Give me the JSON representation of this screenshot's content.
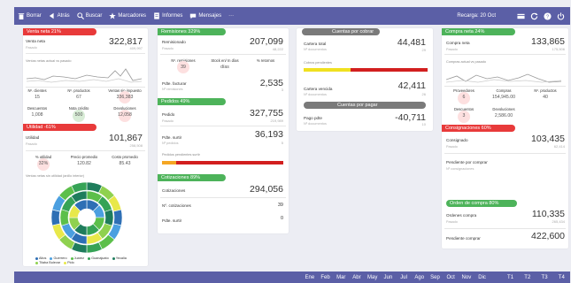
{
  "toolbar": {
    "items": [
      {
        "label": "Borrar"
      },
      {
        "label": "Atrás"
      },
      {
        "label": "Buscar"
      },
      {
        "label": "Marcadores"
      },
      {
        "label": "Informes"
      },
      {
        "label": "Mensajes"
      },
      {
        "label": "···"
      }
    ],
    "recarga": "Recarga: 20 Oct"
  },
  "venta": {
    "header": "Venta neta   21%",
    "title": "Venta neta",
    "subtitle": "Pasado",
    "value": "322,817",
    "past": "409,997",
    "chart_title": "Ventas netas actual vs pasado",
    "m1_label": "Nº. clientes",
    "m1_value": "15",
    "m2_label": "Nº. productos",
    "m2_value": "67",
    "m3_label": "Ventas sin impuesto",
    "m3_value": "336,383",
    "m4_label": "Descuentos",
    "m4_value": "1,008",
    "m5_label": "Nota crédito",
    "m5_value": "500",
    "m6_label": "Devoluciones",
    "m6_value": "12,058"
  },
  "utilidad": {
    "header": "Utilidad  -61%",
    "title": "Utilidad",
    "subtitle": "Pasado",
    "value": "101,867",
    "past": "258,508",
    "m1_label": "% utilidad",
    "m1_value": "32%",
    "m2_label": "Precio promedio",
    "m2_value": "120.82",
    "m3_label": "Costo promedio",
    "m3_value": "85.43",
    "donut_title": "Ventas netas sin utilidad (anillo interior)",
    "legend": [
      {
        "name": "Altos",
        "color": "#2e6fb5"
      },
      {
        "name": "Guerrero",
        "color": "#4b9fe0"
      },
      {
        "name": "Juarez",
        "color": "#5cbf4a"
      },
      {
        "name": "Guanajuato",
        "color": "#36a356"
      },
      {
        "name": "Yecalia",
        "color": "#1f7d5c"
      },
      {
        "name": "Tilaba Bulevar",
        "color": "#8fd14f"
      },
      {
        "name": "Pido",
        "color": "#e8e84a"
      }
    ]
  },
  "remisiones": {
    "header": "Remisiones  329%",
    "title": "Remisionado",
    "subtitle": "Pasado",
    "value": "207,099",
    "past": "48,222",
    "m1_label": "Nº. remisiones",
    "m1_value": "39",
    "m2_label": "Stock en/ In días",
    "m2_value": "días",
    "m3_label": "% retornos",
    "m3_value": "",
    "p_label": "Pdte. facturar",
    "p_sub": "Nº remisiones",
    "p_value": "2,535",
    "p_small": "3"
  },
  "pedidos": {
    "header": "Pedidos  49%",
    "title": "Pedido",
    "subtitle": "Pasado",
    "value": "327,755",
    "past": "219,989",
    "s_label": "Pdte. surtir",
    "s_sub": "Nº pedidos",
    "s_value": "36,193",
    "s_small": "5",
    "bar_label": "Pedidos pendientes surtir",
    "bar_fill": 0.12
  },
  "cotizaciones": {
    "header": "Cotizaciones  89%",
    "title": "Cotizaciones",
    "value": "294,056",
    "n_label": "Nº. cotizaciones",
    "n_value": "39",
    "p_label": "Pdte. surtir",
    "p_value": "0"
  },
  "cobrar": {
    "header": "Cuentas por cobrar",
    "title": "Cartera total",
    "subtitle": "Nº documentos",
    "value": "44,481",
    "small": "29",
    "bar_label": "Cobros pendientes",
    "v_title": "Cartera vencida",
    "v_sub": "Nº documentos",
    "v_value": "42,411",
    "v_small": "26",
    "bar_fill": 0.38
  },
  "pagar": {
    "header": "Cuentas por pagar",
    "title": "Pago pdte",
    "subtitle": "Nº documentos",
    "value": "-40,711",
    "small": "10"
  },
  "compra": {
    "header": "Compra neta   24%",
    "title": "Compra neta",
    "subtitle": "Pasado",
    "value": "133,865",
    "past": "175,506",
    "chart_title": "Compras actual vs pasado",
    "m1_label": "Proveedores",
    "m1_value": "6",
    "m2_label": "Compras",
    "m2_value": "154,945.00",
    "m3_label": "Nº. productos",
    "m3_value": "40",
    "m4_label": "Descuentos",
    "m4_value": "3",
    "m5_label": "Devoluciones",
    "m5_value": "2,586.00"
  },
  "consignaciones": {
    "header": "Consignaciones  60%",
    "title": "Consignado",
    "subtitle": "Pasado",
    "value": "103,435",
    "past": "62,414",
    "p_label": "Pendiente por comprar",
    "p_sub": "Nº consignaciones"
  },
  "orden": {
    "header": "Orden de compra   80%",
    "title": "Ordenes compra",
    "subtitle": "Pasado",
    "value": "110,335",
    "past": "265,434",
    "p_label": "Pendiente comprar",
    "p_value": "422,600"
  },
  "months": [
    "Ene",
    "Feb",
    "Mar",
    "Abr",
    "May",
    "Jun",
    "Jul",
    "Ago",
    "Sep",
    "Oct",
    "Nov",
    "Dic"
  ],
  "quarters": [
    "T1",
    "T2",
    "T3",
    "T4"
  ]
}
